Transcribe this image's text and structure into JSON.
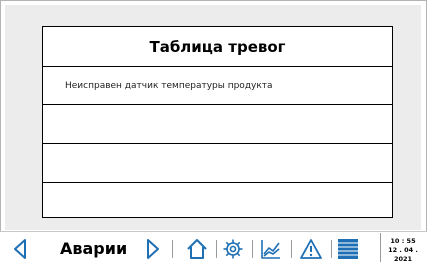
{
  "table": {
    "title": "Таблица тревог",
    "rows": [
      {
        "text": "Неисправен датчик температуры продукта"
      },
      {
        "text": ""
      },
      {
        "text": ""
      },
      {
        "text": ""
      }
    ]
  },
  "nav": {
    "screen_label": "Аварии",
    "icons": [
      "triangle-left-icon",
      "triangle-right-icon",
      "home-icon",
      "gear-icon",
      "chart-icon",
      "warning-icon",
      "list-icon"
    ]
  },
  "clock": {
    "time": "10 : 55",
    "date": "12 . 04 . 2021"
  },
  "colors": {
    "accent": "#1f6fb5",
    "panel_bg": "#ececec"
  }
}
